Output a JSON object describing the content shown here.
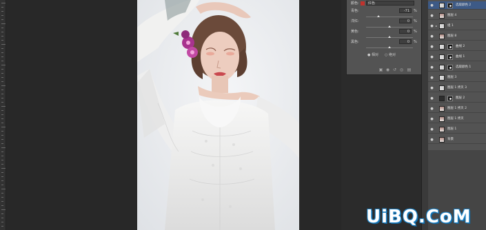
{
  "properties": {
    "preset_label": "颜色:",
    "preset_value": "红色",
    "swatch_color": "#c0322d",
    "sliders": [
      {
        "label": "青色:",
        "value": "-71",
        "unit": "%"
      },
      {
        "label": "洋红:",
        "value": "0",
        "unit": "%"
      },
      {
        "label": "黄色:",
        "value": "0",
        "unit": "%"
      },
      {
        "label": "黑色:",
        "value": "0",
        "unit": "%"
      }
    ],
    "mode_relative": "相对",
    "mode_absolute": "绝对"
  },
  "layers": [
    {
      "name": "选取颜色 2",
      "selected": true,
      "kind": "adj"
    },
    {
      "name": "图层 4",
      "kind": "photo"
    },
    {
      "name": "组 1",
      "kind": "group"
    },
    {
      "name": "图层 8",
      "kind": "photo"
    },
    {
      "name": "曲线 2",
      "kind": "adj-mask"
    },
    {
      "name": "曲线 1",
      "kind": "adj-mask"
    },
    {
      "name": "选取颜色 1",
      "kind": "adj"
    },
    {
      "name": "图层 3",
      "kind": "gray"
    },
    {
      "name": "图层 1 拷贝 3",
      "kind": "gray"
    },
    {
      "name": "图层 2",
      "kind": "mask"
    },
    {
      "name": "图层 1 拷贝 2",
      "kind": "photo"
    },
    {
      "name": "图层 1 拷贝",
      "kind": "photo"
    },
    {
      "name": "图层 1",
      "kind": "photo"
    },
    {
      "name": "背景",
      "kind": "photo"
    }
  ],
  "watermark": "UiBQ.CoM"
}
